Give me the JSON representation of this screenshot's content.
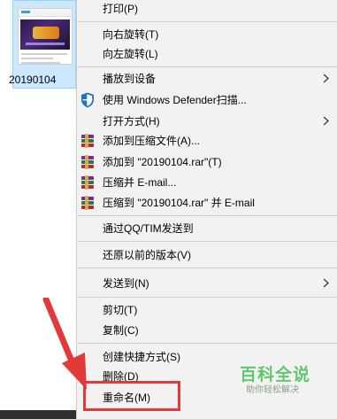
{
  "desktop": {
    "file_name": "20190104"
  },
  "menu": {
    "items": [
      {
        "label": "打印(P)"
      },
      {
        "label": "向右旋转(T)"
      },
      {
        "label": "向左旋转(L)"
      },
      {
        "label": "播放到设备"
      },
      {
        "label": "使用 Windows Defender扫描..."
      },
      {
        "label": "打开方式(H)"
      },
      {
        "label": "添加到压缩文件(A)..."
      },
      {
        "label": "添加到 \"20190104.rar\"(T)"
      },
      {
        "label": "压缩并 E-mail..."
      },
      {
        "label": "压缩到 \"20190104.rar\" 并 E-mail"
      },
      {
        "label": "通过QQ/TIM发送到"
      },
      {
        "label": "还原以前的版本(V)"
      },
      {
        "label": "发送到(N)"
      },
      {
        "label": "剪切(T)"
      },
      {
        "label": "复制(C)"
      },
      {
        "label": "创建快捷方式(S)"
      },
      {
        "label": "删除(D)"
      },
      {
        "label": "重命名(M)"
      }
    ]
  },
  "watermark": {
    "title": "百科全说",
    "subtitle": "助你轻松解决"
  },
  "colors": {
    "menu_bg": "#f2f2f2",
    "highlight": "#e23a3a",
    "watermark": "#5dc76a",
    "selection": "#cce8ff"
  }
}
